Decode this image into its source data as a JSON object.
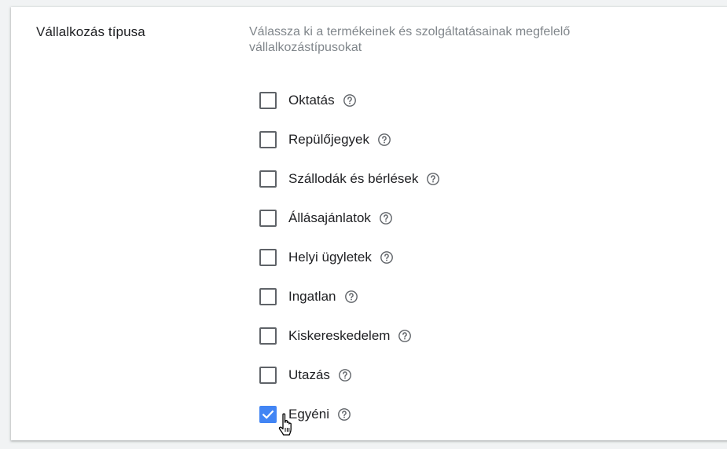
{
  "section": {
    "label": "Vállalkozás típusa",
    "description": "Válassza ki a termékeinek és szolgáltatásainak megfelelő vállalkozástípusokat"
  },
  "options": [
    {
      "label": "Oktatás",
      "checked": false,
      "icon": "help-icon"
    },
    {
      "label": "Repülőjegyek",
      "checked": false,
      "icon": "help-icon"
    },
    {
      "label": "Szállodák és bérlések",
      "checked": false,
      "icon": "help-icon"
    },
    {
      "label": "Állásajánlatok",
      "checked": false,
      "icon": "help-icon"
    },
    {
      "label": "Helyi ügyletek",
      "checked": false,
      "icon": "help-icon"
    },
    {
      "label": "Ingatlan",
      "checked": false,
      "icon": "help-icon"
    },
    {
      "label": "Kiskereskedelem",
      "checked": false,
      "icon": "help-icon"
    },
    {
      "label": "Utazás",
      "checked": false,
      "icon": "help-icon"
    },
    {
      "label": "Egyéni",
      "checked": true,
      "icon": "help-icon"
    }
  ],
  "colors": {
    "accent": "#4285f4",
    "text": "#202124",
    "muted": "#80868b",
    "checkbox_border": "#5f6368"
  }
}
